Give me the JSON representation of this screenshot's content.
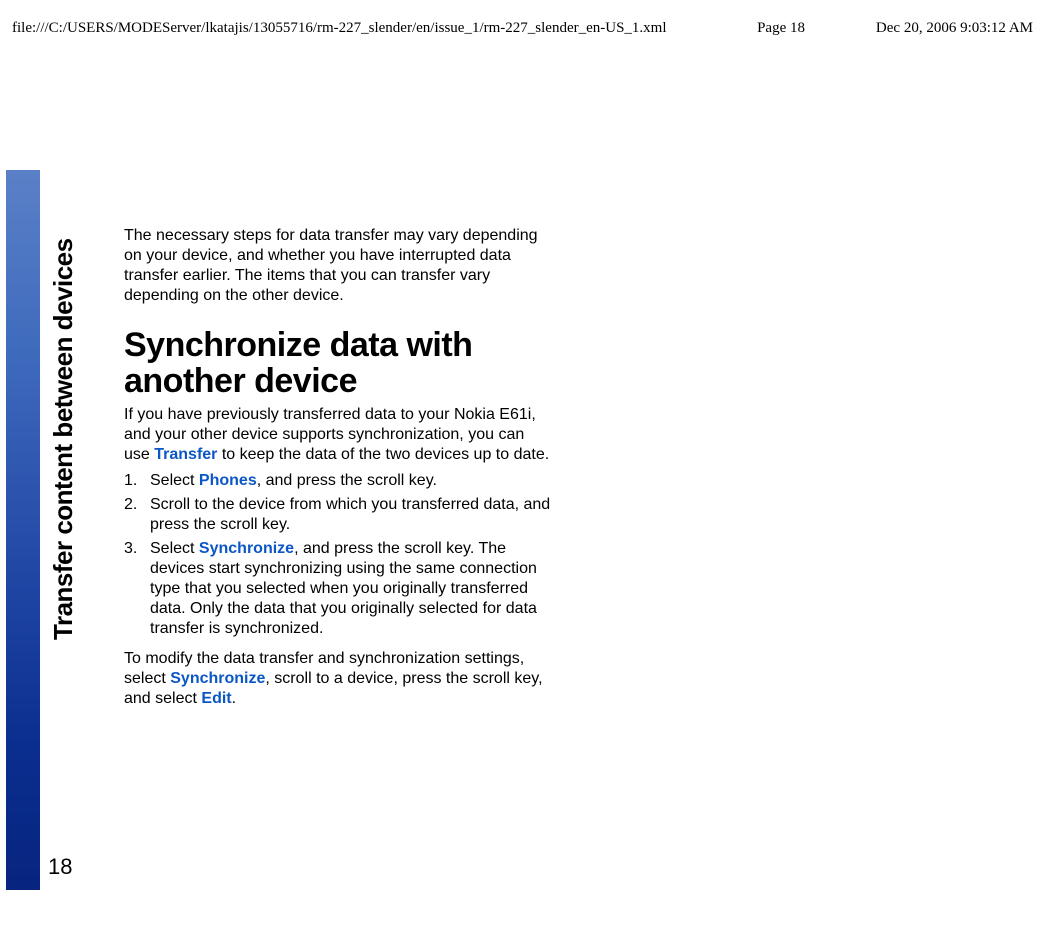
{
  "header": {
    "path": "file:///C:/USERS/MODEServer/lkatajis/13055716/rm-227_slender/en/issue_1/rm-227_slender_en-US_1.xml",
    "page": "Page 18",
    "datetime": "Dec 20, 2006 9:03:12 AM"
  },
  "side_title": "Transfer content between devices",
  "page_number": "18",
  "content": {
    "intro": "The necessary steps for data transfer may vary depending on your device, and whether you have interrupted data transfer earlier. The items that you can transfer vary depending on the other device.",
    "heading": "Synchronize data with another device",
    "lead_a": "If you have previously transferred data to your Nokia E61i, and your other device supports synchronization, you can use ",
    "lead_term": "Transfer",
    "lead_b": " to keep the data of the two devices up to date.",
    "steps": {
      "s1_a": "Select ",
      "s1_term": "Phones",
      "s1_b": ", and press the scroll key.",
      "s2": "Scroll to the device from which you transferred data, and press the scroll key.",
      "s3_a": "Select ",
      "s3_term": "Synchronize",
      "s3_b": ", and press the scroll key. The devices start synchronizing using the same connection type that you selected when you originally transferred data. Only the data that you originally selected for data transfer is synchronized."
    },
    "outro_a": "To modify the data transfer and synchronization settings, select ",
    "outro_term1": "Synchronize",
    "outro_b": ", scroll to a device, press the scroll key, and select ",
    "outro_term2": "Edit",
    "outro_c": "."
  }
}
